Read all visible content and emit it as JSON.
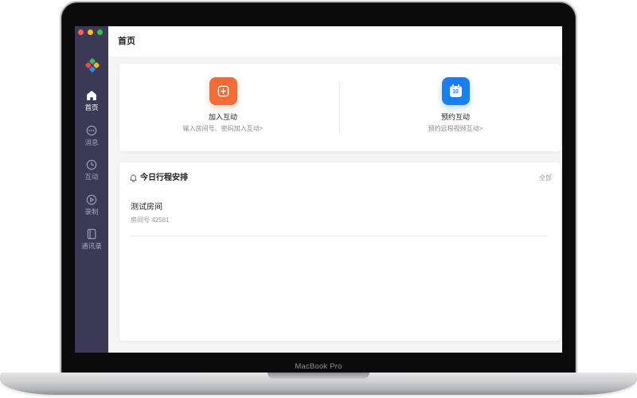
{
  "device": {
    "label": "MacBook Pro"
  },
  "app": {
    "logo": {
      "icon": "app-logo-icon"
    },
    "sidebar": {
      "items": [
        {
          "label": "首页",
          "icon": "home-icon",
          "active": true
        },
        {
          "label": "消息",
          "icon": "message-icon",
          "active": false
        },
        {
          "label": "互动",
          "icon": "clock-icon",
          "active": false
        },
        {
          "label": "录制",
          "icon": "play-circle-icon",
          "active": false
        },
        {
          "label": "通讯录",
          "icon": "contacts-book-icon",
          "active": false
        }
      ]
    },
    "header": {
      "title": "首页"
    },
    "quick_actions": [
      {
        "title": "加入互动",
        "subtitle": "输入房间号、密码加入互动>",
        "icon": "plus-square-icon",
        "color": "#f46b35"
      },
      {
        "title": "预约互动",
        "subtitle": "预约远程视频互动>",
        "icon": "calendar-icon",
        "icon_text": "10",
        "color": "#1b7ff4"
      }
    ],
    "schedule": {
      "icon": "bell-icon",
      "title": "今日行程安排",
      "view_all_label": "全部",
      "items": [
        {
          "name": "测试房间",
          "room_label": "房间号:42581"
        }
      ]
    }
  },
  "colors": {
    "sidebar_bg": "#3b3955",
    "sidebar_active": "#ffffff",
    "sidebar_inactive": "#a3a2b8",
    "page_bg": "#f5f5f7",
    "card_bg": "#ffffff",
    "traffic_lights": [
      "#fe5f57",
      "#febc2e",
      "#28c840"
    ],
    "logo": [
      "#3dbb5c",
      "#f5b623",
      "#2d8cf0",
      "#ef4b3b"
    ]
  }
}
